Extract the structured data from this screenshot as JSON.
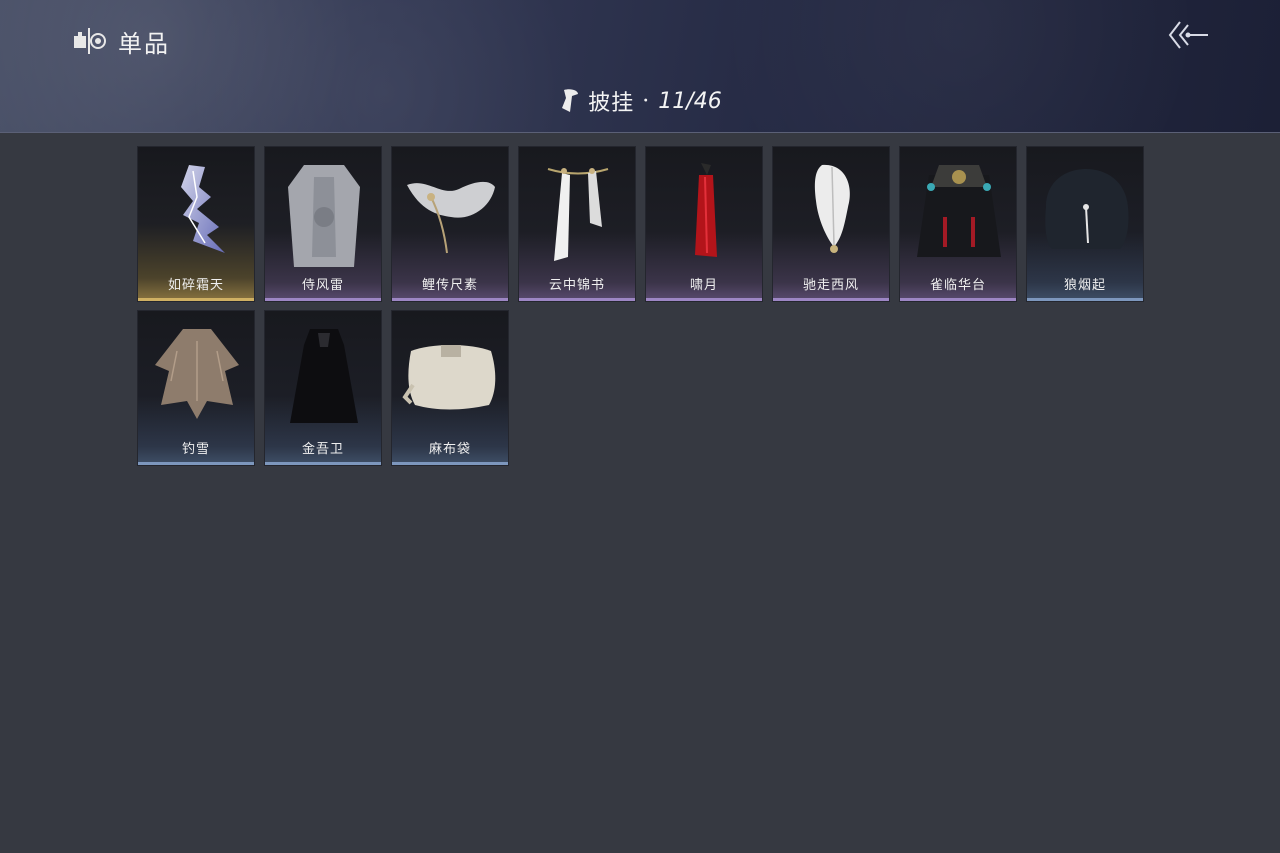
{
  "header": {
    "title": "单品",
    "category_label": "披挂",
    "category_separator": "·",
    "category_count": "11/46"
  },
  "items": [
    {
      "name": "如碎霜天",
      "rarity": "gold",
      "icon": "lightning-cape-icon"
    },
    {
      "name": "侍风雷",
      "rarity": "purple",
      "icon": "grey-robe-icon"
    },
    {
      "name": "鲤传尺素",
      "rarity": "purple",
      "icon": "white-scarf-icon"
    },
    {
      "name": "云中锦书",
      "rarity": "purple",
      "icon": "white-ribbons-icon"
    },
    {
      "name": "啸月",
      "rarity": "purple",
      "icon": "red-feather-icon"
    },
    {
      "name": "驰走西风",
      "rarity": "purple",
      "icon": "white-feather-icon"
    },
    {
      "name": "雀临华台",
      "rarity": "purple",
      "icon": "ornate-cape-icon"
    },
    {
      "name": "狼烟起",
      "rarity": "blue",
      "icon": "fur-cape-icon"
    },
    {
      "name": "钓雪",
      "rarity": "blue",
      "icon": "straw-cape-icon"
    },
    {
      "name": "金吾卫",
      "rarity": "blue",
      "icon": "black-cloak-icon"
    },
    {
      "name": "麻布袋",
      "rarity": "blue",
      "icon": "sack-icon"
    }
  ],
  "colors": {
    "background": "#363941",
    "rarity_gold": "#cfb063",
    "rarity_purple": "#9d86c4",
    "rarity_blue": "#7d97bd"
  }
}
